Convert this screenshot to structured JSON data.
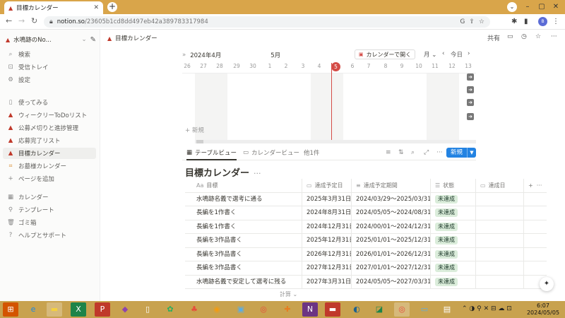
{
  "browser": {
    "tab_title": "目標カレンダー",
    "url_host": "notion.so",
    "url_path": "/23605b1cd8dd497eb42a389783317984",
    "profile_initial": "B"
  },
  "sidebar": {
    "workspace": "水鳴跡のNo...",
    "items": [
      {
        "label": "検索",
        "icon": "search-icon"
      },
      {
        "label": "受信トレイ",
        "icon": "inbox-icon"
      },
      {
        "label": "設定",
        "icon": "gear-icon"
      },
      {
        "label": "使ってみる",
        "icon": "page-icon"
      },
      {
        "label": "ウィークリーToDoリスト",
        "icon": "page-icon"
      },
      {
        "label": "公募〆切りと進捗管理",
        "icon": "page-icon"
      },
      {
        "label": "応募完了リスト",
        "icon": "page-icon"
      },
      {
        "label": "目標カレンダー",
        "icon": "page-icon"
      },
      {
        "label": "お墓様カレンダー",
        "icon": "page-icon"
      },
      {
        "label": "ページを追加",
        "icon": "plus-icon"
      },
      {
        "label": "カレンダー",
        "icon": "calendar-icon"
      },
      {
        "label": "テンプレート",
        "icon": "template-icon"
      },
      {
        "label": "ゴミ箱",
        "icon": "trash-icon"
      },
      {
        "label": "ヘルプとサポート",
        "icon": "help-icon"
      }
    ]
  },
  "topbar": {
    "breadcrumb": "目標カレンダー",
    "share": "共有"
  },
  "timeline": {
    "month_current": "2024年4月",
    "month_next": "5月",
    "open_in_calendar": "カレンダーで開く",
    "month_select": "月",
    "today_label": "今日",
    "days": [
      "26",
      "27",
      "28",
      "29",
      "30",
      "1",
      "2",
      "3",
      "4",
      "5",
      "6",
      "7",
      "8",
      "9",
      "10",
      "11",
      "12",
      "13"
    ],
    "today_day": "5",
    "new_label": "+ 新規"
  },
  "views": {
    "table_view": "テーブルビュー",
    "calendar_view": "カレンダービュー",
    "more_views": "他1件",
    "new_button": "新規"
  },
  "database": {
    "title": "目標カレンダー",
    "columns": [
      "目標",
      "達成予定日",
      "達成予定期間",
      "状態",
      "達成日"
    ],
    "rows": [
      [
        "水鳴跡名義で選考に通る",
        "2025年3月31日",
        "2024/03/29〜2025/03/31",
        "未達成",
        ""
      ],
      [
        "長編を1作書く",
        "2024年8月31日",
        "2024/05/05〜2024/08/31",
        "未達成",
        ""
      ],
      [
        "長編を1作書く",
        "2024年12月31日",
        "2024/00/01〜2024/12/31",
        "未達成",
        ""
      ],
      [
        "長編を3作品書く",
        "2025年12月31日",
        "2025/01/01〜2025/12/31",
        "未達成",
        ""
      ],
      [
        "長編を3作品書く",
        "2026年12月31日",
        "2026/01/01〜2026/12/31",
        "未達成",
        ""
      ],
      [
        "長編を3作品書く",
        "2027年12月31日",
        "2027/01/01〜2027/12/31",
        "未達成",
        ""
      ],
      [
        "水鳴跡名義で安定して選考に残る",
        "2027年3月31日",
        "2024/05/05〜2027/03/31",
        "未達成",
        ""
      ]
    ],
    "calc_label": "計算"
  },
  "taskbar": {
    "time": "6:07",
    "date": "2024/05/05"
  },
  "colors": {
    "accent": "#2383e2",
    "today": "#d44c47",
    "badge_bg": "#dbeddb",
    "tab_strip": "#d9a54a"
  }
}
